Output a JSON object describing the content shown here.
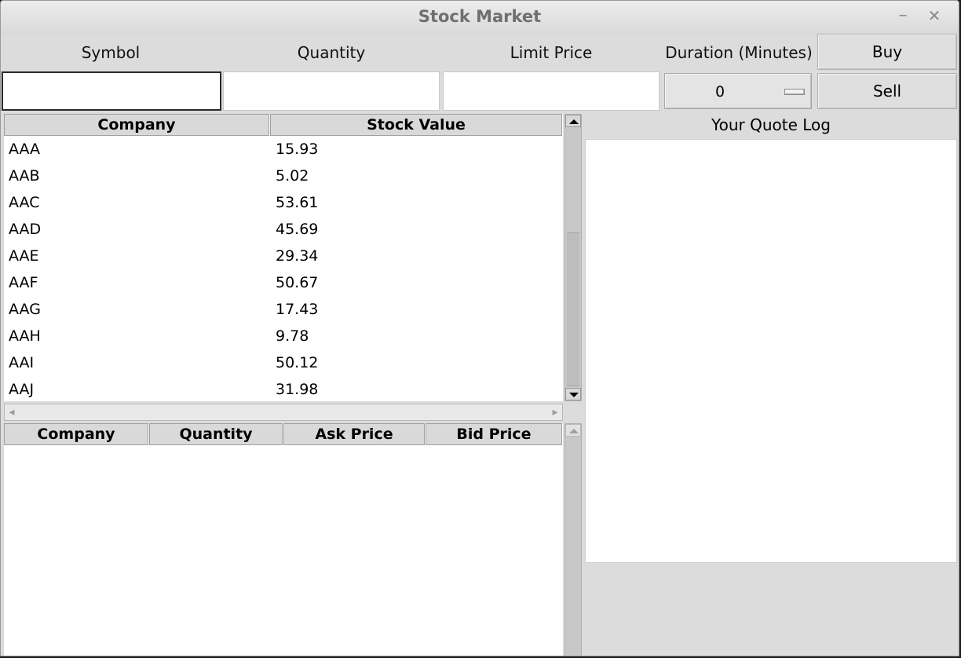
{
  "window": {
    "title": "Stock Market",
    "minimize_glyph": "–",
    "close_glyph": "✕"
  },
  "form": {
    "symbol_label": "Symbol",
    "quantity_label": "Quantity",
    "limit_price_label": "Limit Price",
    "duration_label": "Duration (Minutes)",
    "symbol_value": "",
    "quantity_value": "",
    "limit_price_value": "",
    "duration_value": "0"
  },
  "buttons": {
    "buy": "Buy",
    "sell": "Sell"
  },
  "stock_table": {
    "headers": [
      "Company",
      "Stock Value"
    ],
    "rows": [
      [
        "AAA",
        "15.93"
      ],
      [
        "AAB",
        "5.02"
      ],
      [
        "AAC",
        "53.61"
      ],
      [
        "AAD",
        "45.69"
      ],
      [
        "AAE",
        "29.34"
      ],
      [
        "AAF",
        "50.67"
      ],
      [
        "AAG",
        "17.43"
      ],
      [
        "AAH",
        "9.78"
      ],
      [
        "AAI",
        "50.12"
      ],
      [
        "AAJ",
        "31.98"
      ]
    ]
  },
  "order_table": {
    "headers": [
      "Company",
      "Quantity",
      "Ask Price",
      "Bid Price"
    ],
    "rows": []
  },
  "quote_log": {
    "title": "Your Quote Log",
    "entries": []
  },
  "icons": {
    "scroll_up": "up-arrow-icon",
    "scroll_down": "down-arrow-icon",
    "scroll_left": "left-arrow-icon",
    "scroll_right": "right-arrow-icon"
  }
}
